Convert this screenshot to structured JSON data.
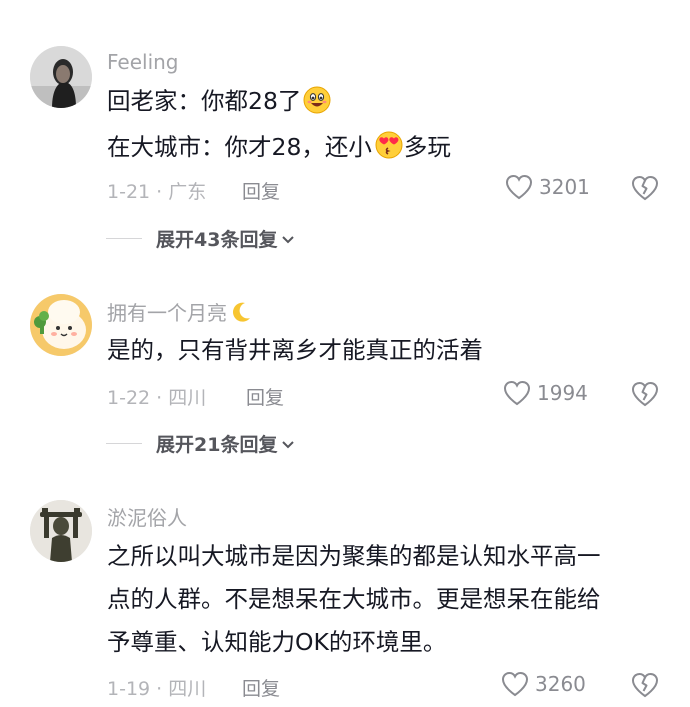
{
  "comments": [
    {
      "username": "Feeling",
      "avatar_icon": "user-photo-avatar",
      "lines": [
        "回老家：你都28了",
        "在大城市：你才28，还小",
        "多玩"
      ],
      "emojis": [
        "grinning-face-emoji",
        "heart-eyes-emoji"
      ],
      "meta": "1-21 · 广东",
      "reply_label": "回复",
      "likes": "3201",
      "expand_label": "展开43条回复"
    },
    {
      "username": "拥有一个月亮",
      "username_icon": "crescent-moon-emoji",
      "avatar_icon": "cartoon-character-avatar",
      "lines": [
        "是的，只有背井离乡才能真正的活着"
      ],
      "meta": "1-22 · 四川",
      "reply_label": "回复",
      "likes": "1994",
      "expand_label": "展开21条回复"
    },
    {
      "username": "淤泥俗人",
      "avatar_icon": "bronze-figure-avatar",
      "lines": [
        "之所以叫大城市是因为聚集的都是认知水平高一",
        "点的人群。不是想呆在大城市。更是想呆在能给",
        "予尊重、认知能力OK的环境里。"
      ],
      "meta": "1-19 · 四川",
      "reply_label": "回复",
      "likes": "3260"
    }
  ],
  "colors": {
    "text_primary": "#161823",
    "text_secondary": "#a3a4a8",
    "icon_gray": "#8a8b91"
  }
}
